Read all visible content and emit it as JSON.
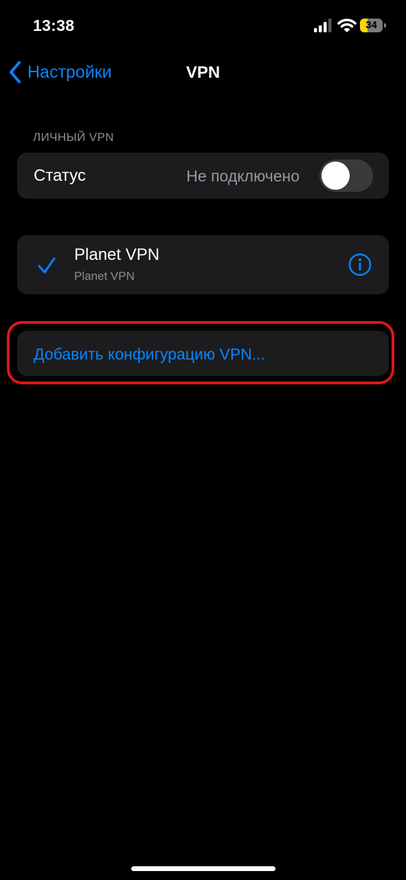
{
  "status_bar": {
    "time": "13:38",
    "battery_level": 34,
    "battery_text": "34",
    "battery_color": "#ffd60a"
  },
  "nav": {
    "back_label": "Настройки",
    "back_icon": "chevron-left-icon",
    "title": "VPN"
  },
  "section": {
    "header": "ЛИЧНЫЙ VPN"
  },
  "status_row": {
    "label": "Статус",
    "value": "Не подключено",
    "toggle_on": false
  },
  "vpn_config": {
    "name": "Planet VPN",
    "subtitle": "Planet VPN",
    "selected": true,
    "info_icon": "info-circle-icon"
  },
  "add_config": {
    "label": "Добавить конфигурацию VPN..."
  },
  "colors": {
    "accent": "#0a84ff",
    "background": "#000000",
    "cell": "#1c1c1e",
    "highlight": "#e0151b"
  }
}
